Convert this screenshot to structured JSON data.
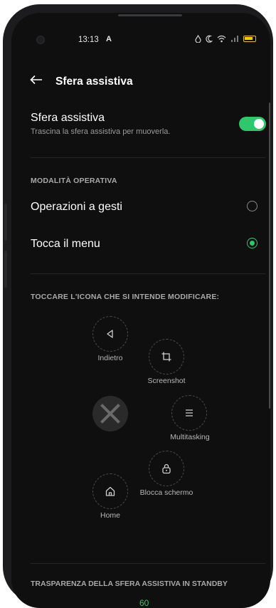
{
  "status_bar": {
    "time": "13:13",
    "indicator": "A",
    "icons": [
      "water-drop-icon",
      "moon-icon",
      "wifi-icon",
      "signal-icon",
      "battery-icon"
    ],
    "battery_color": "#f2d000"
  },
  "app_bar": {
    "back_icon": "arrow-left-icon",
    "title": "Sfera assistiva"
  },
  "main_toggle": {
    "title": "Sfera assistiva",
    "subtitle": "Trascina la sfera assistiva per muoverla.",
    "enabled": true,
    "accent_color": "#2fc76b"
  },
  "mode_section": {
    "label": "MODALITÀ OPERATIVA",
    "options": [
      {
        "label": "Operazioni a gesti",
        "selected": false
      },
      {
        "label": "Tocca il menu",
        "selected": true
      }
    ]
  },
  "icons_section": {
    "label": "TOCCARE L'ICONA CHE SI INTENDE MODIFICARE:",
    "items": [
      {
        "label": "Indietro",
        "icon": "back-triangle-icon"
      },
      {
        "label": "Screenshot",
        "icon": "crop-icon"
      },
      {
        "label": "Multitasking",
        "icon": "menu-lines-icon"
      },
      {
        "label": "Blocca schermo",
        "icon": "lock-icon"
      },
      {
        "label": "Home",
        "icon": "home-icon"
      }
    ],
    "center_icon": "close-icon"
  },
  "transparency_section": {
    "label": "TRASPARENZA DELLA SFERA ASSISTIVA IN STANDBY",
    "value": "60"
  }
}
